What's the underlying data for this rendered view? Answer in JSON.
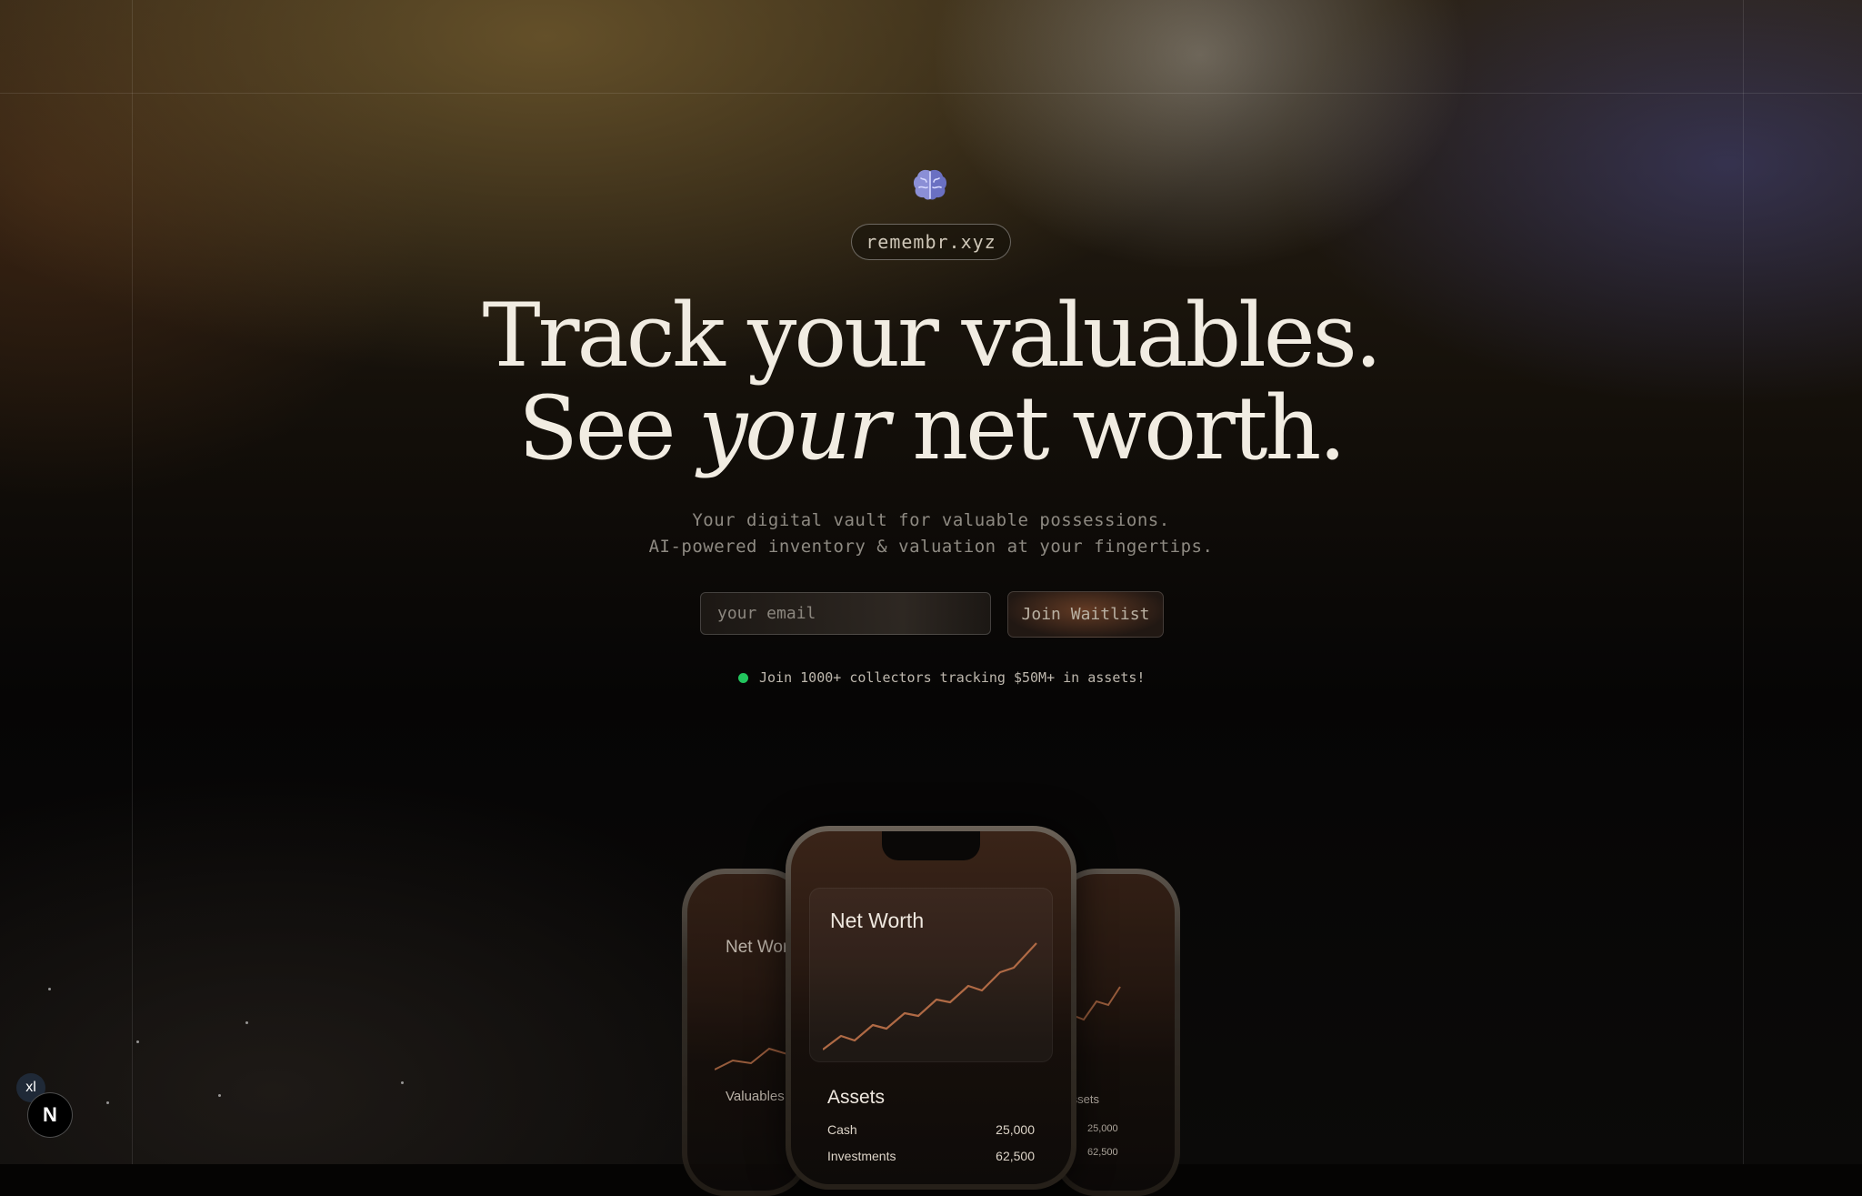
{
  "brand": {
    "domain": "remembr.xyz",
    "logo_icon": "brain-icon"
  },
  "hero": {
    "line1": "Track your valuables.",
    "line2_before": "See",
    "line2_em": "your",
    "line2_after": "net worth.",
    "sub1": "Your digital vault for valuable possessions.",
    "sub2": "AI-powered inventory & valuation at your fingertips."
  },
  "waitlist": {
    "email_placeholder": "your email",
    "email_value": "",
    "button_label": "Join Waitlist"
  },
  "social_proof": {
    "text": "Join 1000+ collectors tracking $50M+ in assets!",
    "dot_color": "#22c55e"
  },
  "phone_center": {
    "title": "Net Worth",
    "assets_title": "Assets",
    "rows": [
      {
        "label": "Cash",
        "value": "25,000"
      },
      {
        "label": "Investments",
        "value": "62,500"
      }
    ]
  },
  "phone_left": {
    "title": "Net Worth",
    "section": "Valuables"
  },
  "phone_right": {
    "section": "Assets",
    "values": [
      "25,000",
      "62,500"
    ]
  },
  "dev": {
    "breakpoint": "xl",
    "next_icon": "N"
  },
  "colors": {
    "accent_line": "#b06a45",
    "bg": "#050403"
  }
}
